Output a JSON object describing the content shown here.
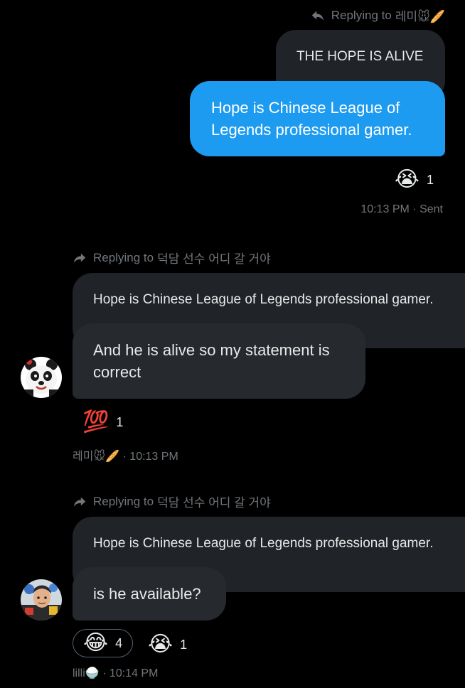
{
  "msg1": {
    "reply_prefix": "Replying to",
    "reply_target": "레미🐭🥖",
    "quoted_text": "THE HOPE IS ALIVE",
    "text": "Hope is Chinese League of Legends professional gamer.",
    "reaction_emoji": "😭",
    "reaction_count": "1",
    "time_status": "10:13 PM · Sent"
  },
  "msg2": {
    "reply_prefix": "Replying to",
    "reply_target": "덕담 선수 어디 갈 거야",
    "quoted_text": "Hope is Chinese League of Legends professional gamer.",
    "text": "And he is alive so my statement is correct",
    "reaction_emoji": "💯",
    "reaction_count": "1",
    "sender": "레미🐭🥖",
    "time": "· 10:13 PM",
    "avatar": "panda-avatar"
  },
  "msg3": {
    "reply_prefix": "Replying to",
    "reply_target": "덕담 선수 어디 갈 거야",
    "quoted_text": "Hope is Chinese League of Legends professional gamer.",
    "text": "is he available?",
    "reactions": [
      {
        "emoji": "😂",
        "count": "4"
      },
      {
        "emoji": "😭",
        "count": "1"
      }
    ],
    "sender": "lilli🍚",
    "time": "· 10:14 PM",
    "avatar": "person-avatar"
  },
  "colors": {
    "background": "#000000",
    "sent_bubble": "#1d9bf0",
    "received_bubble": "#26292d",
    "quoted_bubble": "#202327",
    "muted_text": "#71767b"
  }
}
